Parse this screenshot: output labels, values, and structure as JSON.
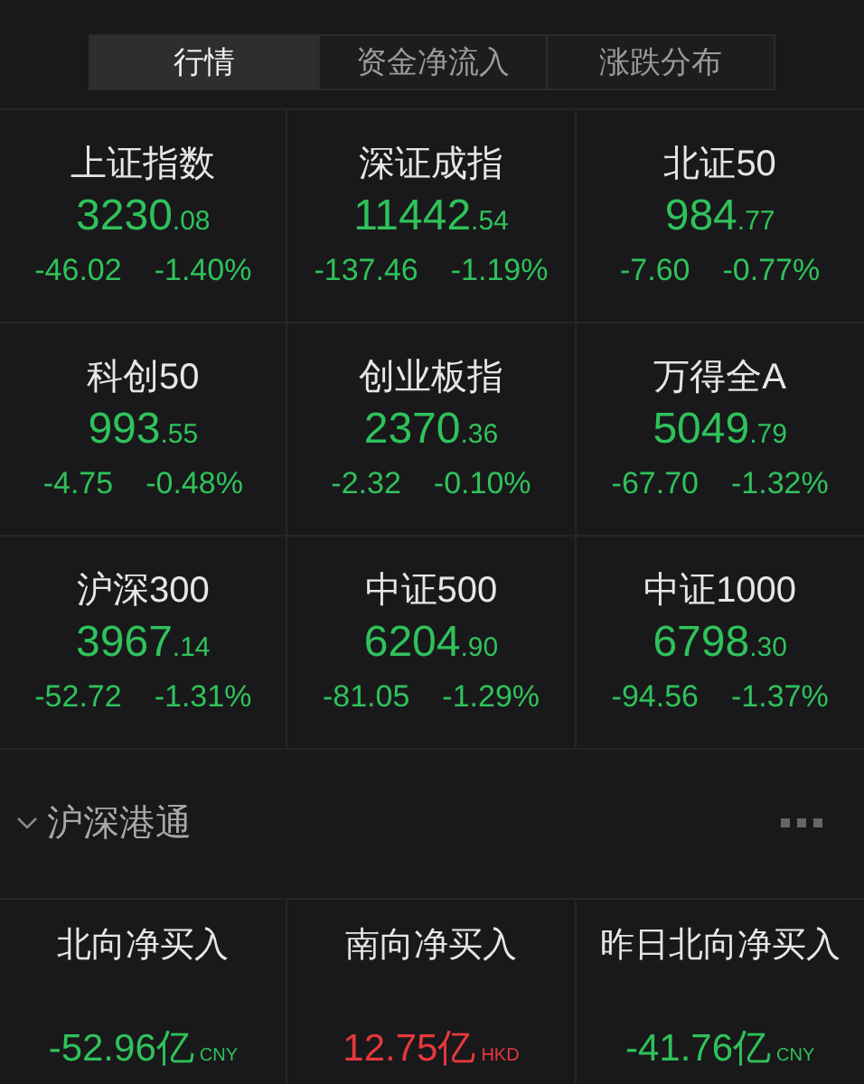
{
  "tabs": [
    {
      "label": "行情",
      "selected": true
    },
    {
      "label": "资金净流入",
      "selected": false
    },
    {
      "label": "涨跌分布",
      "selected": false
    }
  ],
  "indices": [
    {
      "name": "上证指数",
      "value_int": "3230",
      "value_dec": ".08",
      "change": "-46.02",
      "percent": "-1.40%",
      "color": "#2fc25b"
    },
    {
      "name": "深证成指",
      "value_int": "11442",
      "value_dec": ".54",
      "change": "-137.46",
      "percent": "-1.19%",
      "color": "#2fc25b"
    },
    {
      "name": "北证50",
      "value_int": "984",
      "value_dec": ".77",
      "change": "-7.60",
      "percent": "-0.77%",
      "color": "#2fc25b"
    },
    {
      "name": "科创50",
      "value_int": "993",
      "value_dec": ".55",
      "change": "-4.75",
      "percent": "-0.48%",
      "color": "#2fc25b"
    },
    {
      "name": "创业板指",
      "value_int": "2370",
      "value_dec": ".36",
      "change": "-2.32",
      "percent": "-0.10%",
      "color": "#2fc25b"
    },
    {
      "name": "万得全A",
      "value_int": "5049",
      "value_dec": ".79",
      "change": "-67.70",
      "percent": "-1.32%",
      "color": "#2fc25b"
    },
    {
      "name": "沪深300",
      "value_int": "3967",
      "value_dec": ".14",
      "change": "-52.72",
      "percent": "-1.31%",
      "color": "#2fc25b"
    },
    {
      "name": "中证500",
      "value_int": "6204",
      "value_dec": ".90",
      "change": "-81.05",
      "percent": "-1.29%",
      "color": "#2fc25b"
    },
    {
      "name": "中证1000",
      "value_int": "6798",
      "value_dec": ".30",
      "change": "-94.56",
      "percent": "-1.37%",
      "color": "#2fc25b"
    }
  ],
  "connect_section": {
    "title": "沪深港通",
    "expanded": true,
    "flows": [
      {
        "label": "北向净买入",
        "amount": "-52.96亿",
        "currency": "CNY",
        "color": "#2fc25b"
      },
      {
        "label": "南向净买入",
        "amount": "12.75亿",
        "currency": "HKD",
        "color": "#e8383d"
      },
      {
        "label": "昨日北向净买入",
        "amount": "-41.76亿",
        "currency": "CNY",
        "color": "#2fc25b"
      }
    ]
  }
}
